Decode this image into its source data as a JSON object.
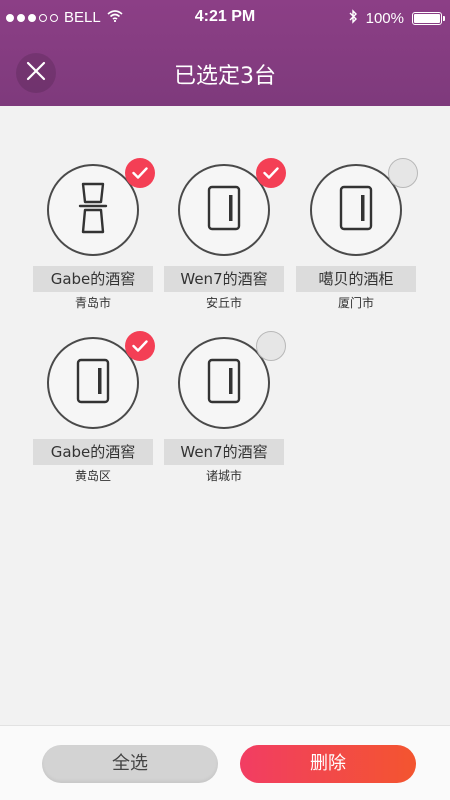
{
  "status_bar": {
    "carrier": "BELL",
    "signal_bars_filled": 3,
    "signal_bars_total": 5,
    "time": "4:21 PM",
    "battery": "100%",
    "icons": [
      "wifi-icon",
      "bluetooth-icon",
      "battery-icon"
    ]
  },
  "header": {
    "title": "已选定3台",
    "close_icon": "close-icon",
    "background_color": "#8c3f86"
  },
  "devices": [
    {
      "name": "Gabe的酒窖",
      "city": "青岛市",
      "selected": true,
      "icon": "wine-rack-icon"
    },
    {
      "name": "Wen7的酒窖",
      "city": "安丘市",
      "selected": true,
      "icon": "cabinet-icon"
    },
    {
      "name": "噶贝的酒柜",
      "city": "厦门市",
      "selected": false,
      "icon": "cabinet-icon"
    },
    {
      "name": "Gabe的酒窖",
      "city": "黄岛区",
      "selected": true,
      "icon": "cabinet-icon"
    },
    {
      "name": "Wen7的酒窖",
      "city": "诸城市",
      "selected": false,
      "icon": "cabinet-icon"
    }
  ],
  "footer": {
    "select_all_label": "全选",
    "delete_label": "删除",
    "delete_color": "#f23d63"
  }
}
